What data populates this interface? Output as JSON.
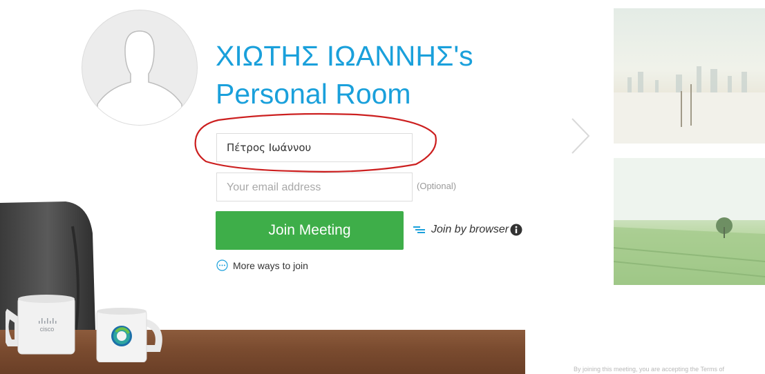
{
  "room": {
    "title_line1": "ΧΙΩΤΗΣ ΙΩΑΝΝΗΣ's",
    "title_line2": "Personal Room"
  },
  "form": {
    "name_value": "Πέτρος Ιωάννου",
    "email_placeholder": "Your email address",
    "optional_label": "(Optional)",
    "join_button_label": "Join Meeting",
    "join_by_browser_label": "Join by browser",
    "more_ways_label": "More ways to join"
  },
  "mug": {
    "brand_text": "cisco"
  },
  "footer": {
    "terms_text": "By joining this meeting, you are accepting the Terms of"
  },
  "colors": {
    "title_accent": "#1aa0db",
    "join_button": "#3eae49",
    "annotation": "#cc1f1f"
  },
  "icons": [
    "avatar-silhouette-icon",
    "browser-lines-icon",
    "info-icon",
    "more-dots-icon",
    "chevron-right-icon"
  ]
}
